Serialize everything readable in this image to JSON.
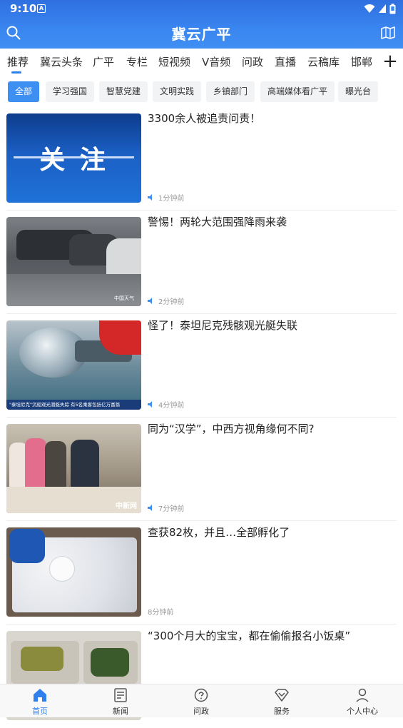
{
  "status_bar": {
    "time": "9:10",
    "notify_icon_letter": "A"
  },
  "app": {
    "title": "冀云广平"
  },
  "tabs": [
    {
      "label": "推荐"
    },
    {
      "label": "冀云头条"
    },
    {
      "label": "广平"
    },
    {
      "label": "专栏"
    },
    {
      "label": "短视频"
    },
    {
      "label": "V音频"
    },
    {
      "label": "问政"
    },
    {
      "label": "直播"
    },
    {
      "label": "云稿库"
    },
    {
      "label": "邯郸"
    }
  ],
  "chips": [
    {
      "label": "全部"
    },
    {
      "label": "学习强国"
    },
    {
      "label": "智慧党建"
    },
    {
      "label": "文明实践"
    },
    {
      "label": "乡镇部门"
    },
    {
      "label": "高端媒体看广平"
    },
    {
      "label": "曝光台"
    }
  ],
  "feed": [
    {
      "title": "3300余人被追责问责！",
      "time": "1分钟前",
      "audio": true,
      "thumb_text": "关  注"
    },
    {
      "title": "警惕！两轮大范围强降雨来袭",
      "time": "2分钟前",
      "audio": true,
      "thumb_text": "中国天气"
    },
    {
      "title": "怪了！泰坦尼克残骸观光艇失联",
      "time": "4分钟前",
      "audio": true,
      "thumb_text": "\"泰坦尼克\"沉船观光潜艇失踪 有5名乘客包括亿万富翁"
    },
    {
      "title": "同为“汉学”，中西方视角缘何不同?",
      "time": "7分钟前",
      "audio": true,
      "thumb_text": "中新网"
    },
    {
      "title": "查获82枚，并且…全部孵化了",
      "time": "8分钟前",
      "audio": false,
      "thumb_text": ""
    },
    {
      "title": "“300个月大的宝宝，都在偷偷报名小饭桌”",
      "time": "",
      "audio": false,
      "thumb_text": ""
    }
  ],
  "bottom_nav": [
    {
      "label": "首页",
      "icon": "home-icon"
    },
    {
      "label": "新闻",
      "icon": "news-icon"
    },
    {
      "label": "问政",
      "icon": "inquiry-icon"
    },
    {
      "label": "服务",
      "icon": "service-icon"
    },
    {
      "label": "个人中心",
      "icon": "profile-icon"
    }
  ],
  "colors": {
    "accent": "#2f80ed",
    "header": "#3a86f0"
  }
}
